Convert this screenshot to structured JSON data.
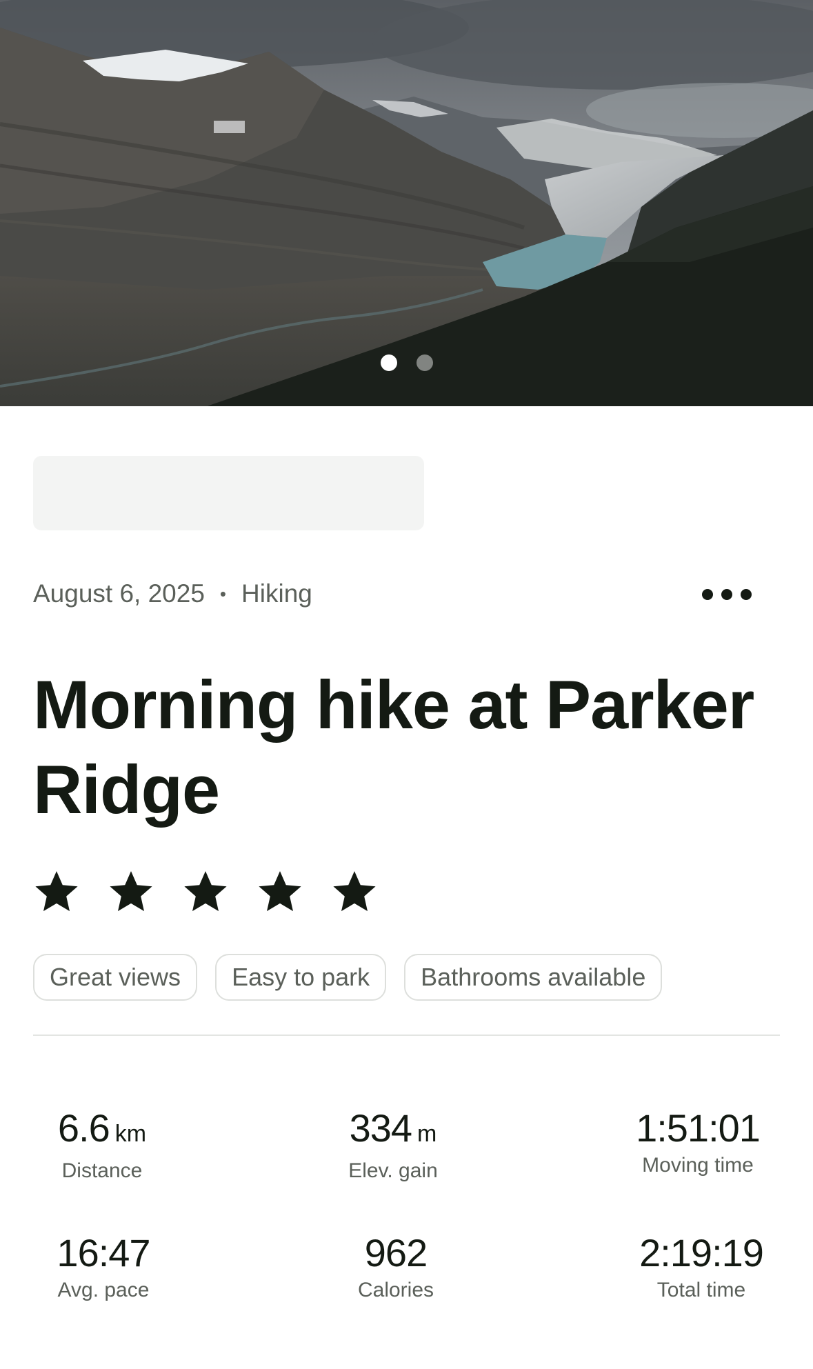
{
  "carousel": {
    "dots": [
      {
        "active": true
      },
      {
        "active": false
      }
    ]
  },
  "meta": {
    "date": "August 6, 2025",
    "separator": "•",
    "activity_type": "Hiking"
  },
  "more_icon": "more-horizontal-icon",
  "title": "Morning hike at Parker Ridge",
  "rating": {
    "value": 5,
    "max": 5,
    "color": "#141a13"
  },
  "tags": [
    "Great views",
    "Easy to park",
    "Bathrooms available"
  ],
  "stats": {
    "distance": {
      "value": "6.6",
      "unit": "km",
      "label": "Distance"
    },
    "elev_gain": {
      "value": "334",
      "unit": "m",
      "label": "Elev. gain"
    },
    "moving_time": {
      "value": "1:51:01",
      "label": "Moving time"
    },
    "avg_pace": {
      "value": "16:47",
      "label": "Avg. pace"
    },
    "calories": {
      "value": "962",
      "label": "Calories"
    },
    "total_time": {
      "value": "2:19:19",
      "label": "Total time"
    }
  },
  "colors": {
    "text_primary": "#141a13",
    "text_secondary": "#5b605a",
    "tag_border": "#dddfdc",
    "placeholder": "#f3f4f3"
  }
}
